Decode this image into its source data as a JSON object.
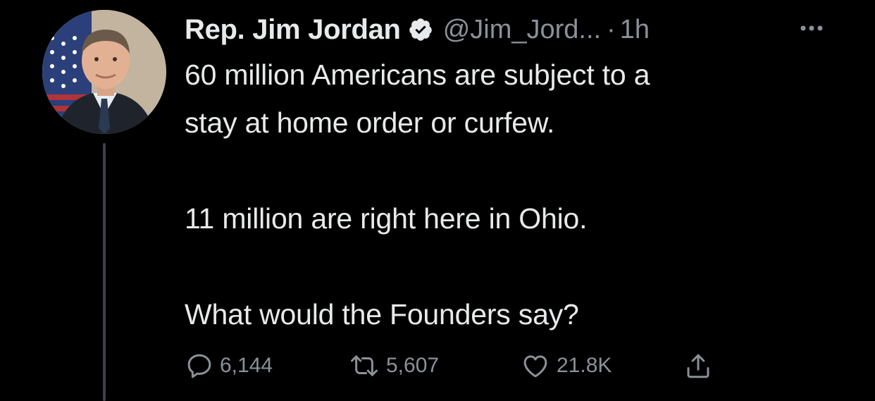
{
  "tweet": {
    "author": {
      "display_name": "Rep. Jim Jordan",
      "handle": "@Jim_Jord...",
      "verified": true
    },
    "separator": "·",
    "time": "1h",
    "more_icon": "more-horizontal-icon",
    "text": "60 million Americans are subject to a\nstay at home order or curfew.\n\n11 million are right here in Ohio.\n\nWhat would the Founders say?",
    "actions": {
      "reply_count": "6,144",
      "retweet_count": "5,607",
      "like_count": "21.8K"
    }
  },
  "colors": {
    "background": "#000000",
    "text_primary": "#e7e9ea",
    "text_secondary": "#8b9198",
    "thread_line": "#3d4249"
  }
}
